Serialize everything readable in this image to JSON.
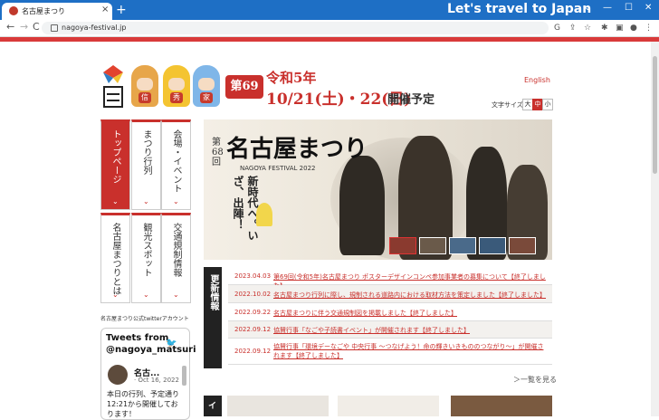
{
  "browser": {
    "tab_title": "名古屋まつり",
    "tab_close": "×",
    "new_tab": "+",
    "window_title": "Let's travel to Japan",
    "url": "nagoya-festival.jp",
    "nav_back": "←",
    "nav_forward": "→",
    "nav_reload": "C"
  },
  "header": {
    "edition_badge": "第69回",
    "era": "令和5年",
    "dates": "10/21(土)・22(日)",
    "plan_suffix": "開催予定",
    "english_link": "English",
    "font_size_label": "文字サイズ",
    "font_sizes": [
      "大",
      "中",
      "小"
    ]
  },
  "mascots": [
    {
      "badge": "信"
    },
    {
      "badge": "秀"
    },
    {
      "badge": "家"
    }
  ],
  "nav": [
    {
      "label": "トップページ",
      "active": true
    },
    {
      "label": "まつり行列",
      "active": false
    },
    {
      "label": "会場・イベント",
      "active": false
    },
    {
      "label": "名古屋まつりとは",
      "active": false
    },
    {
      "label": "観光スポット",
      "active": false
    },
    {
      "label": "交通規制情報",
      "active": false
    }
  ],
  "nav_chevron": "⌄",
  "hero": {
    "edition_vertical": "第68回",
    "title": "名古屋まつり",
    "subtitle": "NAGOYA FESTIVAL 2022",
    "slogan": "新時代へ。いざ、出陣！"
  },
  "twitter": {
    "section_label": "名古屋まつり公式twitterアカウント",
    "widget_title": "Tweets from @nagoya_matsuri",
    "bird": "🐦",
    "account_name": "名古...",
    "date": "· Oct 16, 2022",
    "tweet_text": "本日の行列、予定通り12:21から開催しております！"
  },
  "news": {
    "label": "更新情報",
    "items": [
      {
        "date": "2023.04.03",
        "text": "第69回(令和5年)名古屋まつり ポスターデザインコンペ参加事業者の募集について【終了しました】"
      },
      {
        "date": "2022.10.02",
        "text": "名古屋まつり行列に際し、規制される道路内における取材方法を策定しました【終了しました】"
      },
      {
        "date": "2022.09.22",
        "text": "名古屋まつりに伴う交通規制図を掲載しました【終了しました】"
      },
      {
        "date": "2022.09.12",
        "text": "協賛行事「なごや子読書イベント」が開催されます【終了しました】"
      },
      {
        "date": "2022.09.12",
        "text": "協賛行事「環境デーなごや 中央行事 〜つなげよう！命の輝きいきもののつながり〜」が開催されます【終了しました】"
      }
    ],
    "more_link": "＞一覧を見る"
  },
  "bottom": {
    "label": "イ"
  },
  "colors": {
    "brand_red": "#c9302c",
    "chrome_blue": "#1e6fc5"
  }
}
